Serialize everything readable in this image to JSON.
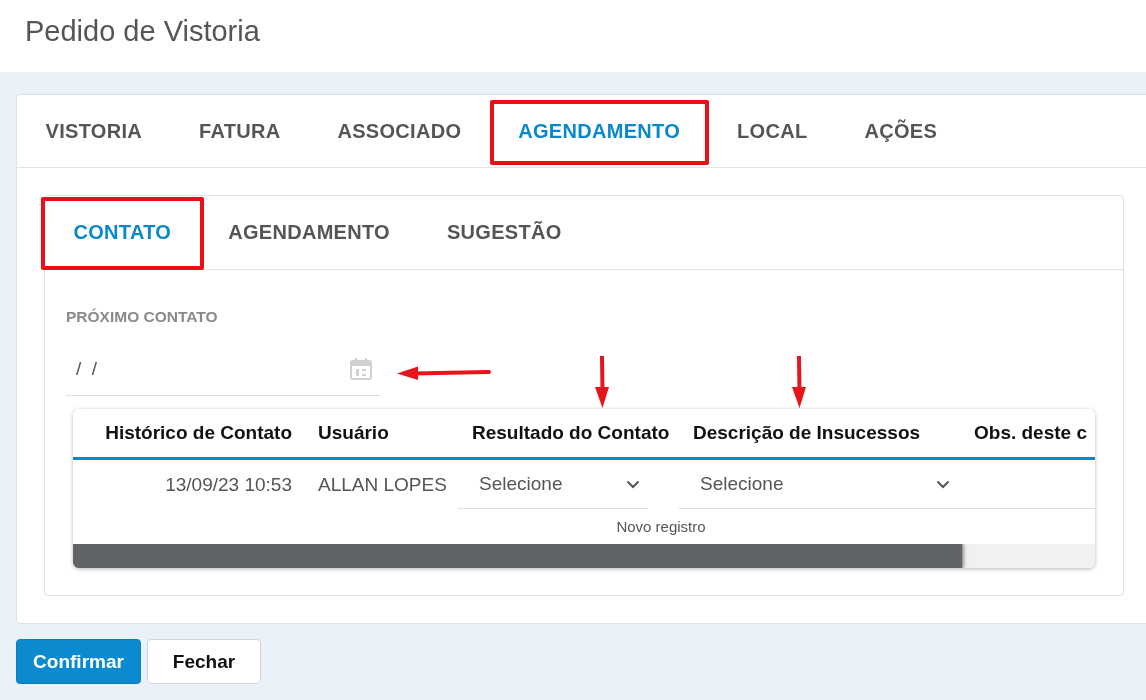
{
  "page": {
    "title": "Pedido de Vistoria"
  },
  "tabs": [
    {
      "label": "VISTORIA",
      "selected": false,
      "highlighted": false
    },
    {
      "label": "FATURA",
      "selected": false,
      "highlighted": false
    },
    {
      "label": "ASSOCIADO",
      "selected": false,
      "highlighted": false
    },
    {
      "label": "AGENDAMENTO",
      "selected": true,
      "highlighted": true
    },
    {
      "label": "LOCAL",
      "selected": false,
      "highlighted": false
    },
    {
      "label": "AÇÕES",
      "selected": false,
      "highlighted": false
    }
  ],
  "subtabs": [
    {
      "label": "CONTATO",
      "selected": true,
      "highlighted": true
    },
    {
      "label": "AGENDAMENTO",
      "selected": false,
      "highlighted": false
    },
    {
      "label": "SUGESTÃO",
      "selected": false,
      "highlighted": false
    }
  ],
  "next_contact": {
    "label": "PRÓXIMO CONTATO",
    "value": "/  /",
    "pointer_arrow": true
  },
  "contact_table": {
    "columns": [
      {
        "label": "Histórico de Contato",
        "pointer_arrow": false
      },
      {
        "label": "Usuário",
        "pointer_arrow": false
      },
      {
        "label": "Resultado do Contato",
        "pointer_arrow": true
      },
      {
        "label": "Descrição de Insucessos",
        "pointer_arrow": true
      },
      {
        "label": "Obs. deste c",
        "pointer_arrow": false
      }
    ],
    "rows": [
      {
        "cells": [
          {
            "kind": "text",
            "value": "13/09/23 10:53"
          },
          {
            "kind": "text",
            "value": "ALLAN LOPES"
          },
          {
            "kind": "select",
            "value": "Selecione"
          },
          {
            "kind": "select",
            "value": "Selecione"
          },
          {
            "kind": "input"
          }
        ]
      }
    ],
    "footer": "Novo registro"
  },
  "buttons": [
    {
      "label": "Confirmar",
      "kind": "primary"
    },
    {
      "label": "Fechar",
      "kind": "secondary"
    }
  ]
}
